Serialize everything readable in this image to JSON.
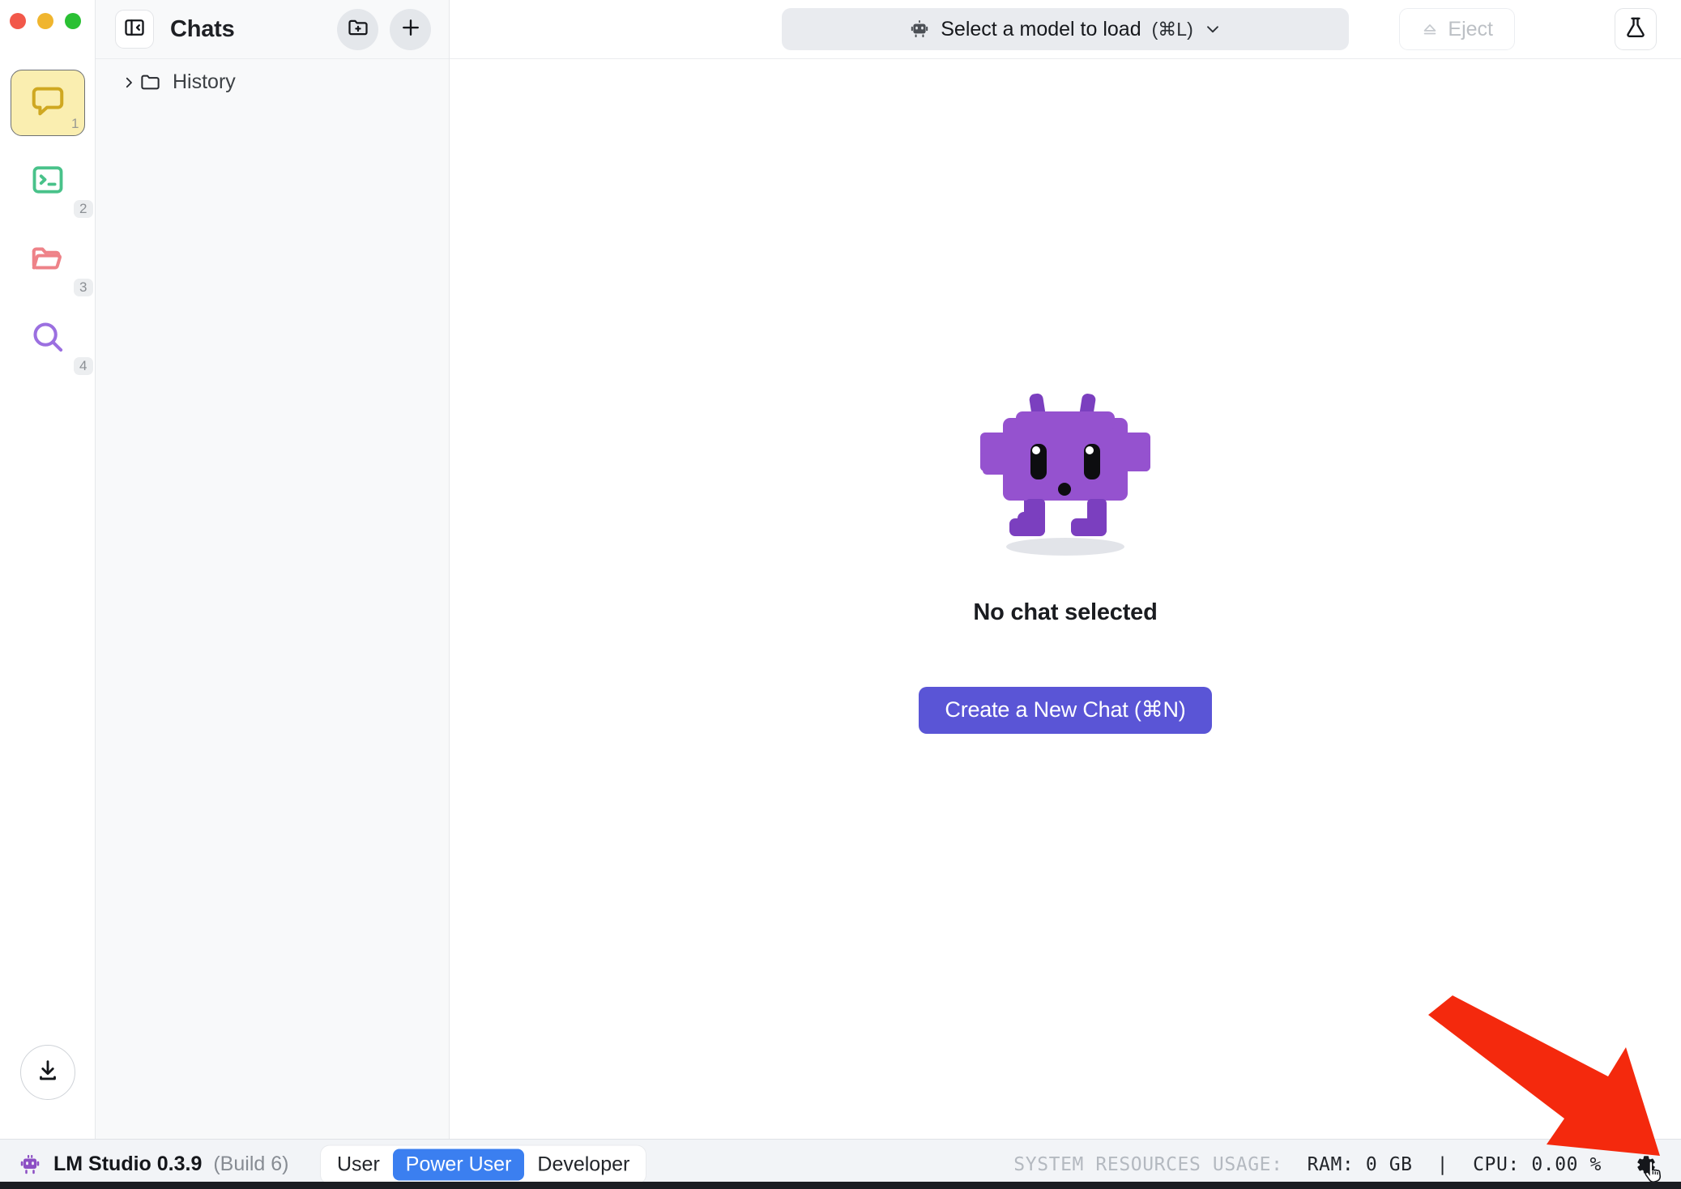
{
  "window": {
    "traffic_lights": [
      "close",
      "minimize",
      "maximize"
    ]
  },
  "rail": {
    "items": [
      {
        "icon": "chat-bubble-icon",
        "badge": "1",
        "active": true,
        "name": "chat"
      },
      {
        "icon": "terminal-icon",
        "badge": "2",
        "active": false,
        "name": "developer"
      },
      {
        "icon": "folder-icon",
        "badge": "3",
        "active": false,
        "name": "my-models"
      },
      {
        "icon": "search-icon",
        "badge": "4",
        "active": false,
        "name": "discover"
      }
    ],
    "download_icon": "download-icon"
  },
  "chat_panel": {
    "toggle_icon": "sidebar-toggle-icon",
    "title": "Chats",
    "new_folder_icon": "folder-plus-icon",
    "new_chat_icon": "plus-icon",
    "tree": [
      {
        "label": "History",
        "icon": "folder-icon",
        "chevron": "chevron-right-icon",
        "expanded": false
      }
    ]
  },
  "topbar": {
    "model_selector": {
      "icon": "robot-icon",
      "label": "Select a model to load",
      "shortcut": "(⌘L)",
      "chevron": "chevron-down-icon"
    },
    "eject": {
      "icon": "eject-icon",
      "label": "Eject",
      "disabled": true
    },
    "flask": {
      "icon": "flask-icon"
    }
  },
  "empty_state": {
    "mascot": "lm-studio-robot-mascot",
    "title": "No chat selected",
    "button_label": "Create a New Chat (⌘N)"
  },
  "annotation": {
    "arrow": "red-arrow-pointing-to-settings-gear",
    "color": "#f4290d"
  },
  "statusbar": {
    "logo": "lm-studio-logo",
    "app_name": "LM Studio 0.3.9",
    "build": "(Build 6)",
    "modes": [
      {
        "label": "User",
        "selected": false
      },
      {
        "label": "Power User",
        "selected": true
      },
      {
        "label": "Developer",
        "selected": false
      }
    ],
    "system_resources_label": "SYSTEM RESOURCES USAGE:",
    "ram": "RAM: 0 GB",
    "separator": "|",
    "cpu": "CPU: 0.00 %",
    "settings_icon": "gear-icon",
    "cursor": "pointing-hand-cursor"
  },
  "colors": {
    "accent_purple": "#5a55d6",
    "robot_body": "#9552cf",
    "robot_dark": "#7b3fbf",
    "mode_blue": "#3b7ff0",
    "arrow_red": "#f4290d",
    "rail_active_bg": "#faeeb0"
  }
}
